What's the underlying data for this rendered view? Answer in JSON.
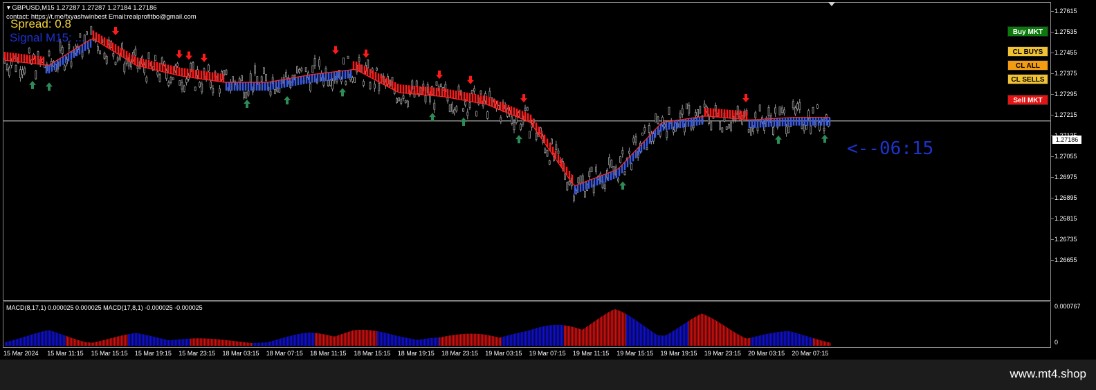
{
  "header": {
    "symbol_line": "GBPUSD,M15  1.27287 1.27287 1.27184 1.27186",
    "contact": "contact:  https://t.me/fxyashwinbest Email:realprofitbo@gmail.com",
    "spread": "Spread: 0.8",
    "signal": "Signal M15: ..."
  },
  "countdown": "<--06:15",
  "buttons": {
    "buy": "Buy MKT",
    "cl_buys": "CL BUYS",
    "cl_all": "CL ALL",
    "cl_sells": "CL SELLS",
    "sell": "Sell MKT"
  },
  "price_axis": {
    "ticks": [
      "1.27615",
      "1.27535",
      "1.27455",
      "1.27375",
      "1.27295",
      "1.27215",
      "1.27135",
      "1.27055",
      "1.26975",
      "1.26895",
      "1.26815",
      "1.26735",
      "1.26655"
    ],
    "current": "1.27186"
  },
  "time_axis": [
    "15 Mar 2024",
    "15 Mar 11:15",
    "15 Mar 15:15",
    "15 Mar 19:15",
    "15 Mar 23:15",
    "18 Mar 03:15",
    "18 Mar 07:15",
    "18 Mar 11:15",
    "18 Mar 15:15",
    "18 Mar 19:15",
    "18 Mar 23:15",
    "19 Mar 03:15",
    "19 Mar 07:15",
    "19 Mar 11:15",
    "19 Mar 15:15",
    "19 Mar 19:15",
    "19 Mar 23:15",
    "20 Mar 03:15",
    "20 Mar 07:15"
  ],
  "macd": {
    "label": "MACD(8,17,1) 0.000025 0.000025  MACD(17,8,1) -0.000025 -0.000025",
    "axis_top": "0.000767",
    "axis_zero": "0"
  },
  "watermark": "www.mt4.shop",
  "colors": {
    "up_arrow": "#2e8b57",
    "down_arrow": "#ff1a1a",
    "trend_up": "#3a5be0",
    "trend_down": "#ff1a1a",
    "candle": "#9a9a9a",
    "macd_up": "#1010d0",
    "macd_down": "#d01010"
  },
  "chart_data": {
    "type": "candlestick",
    "symbol": "GBPUSD",
    "timeframe": "M15",
    "last_price": 1.27186,
    "ylim": [
      1.26655,
      1.27655
    ],
    "trend_line": [
      {
        "t": "15 Mar 2024",
        "price": 1.2742
      },
      {
        "t": "15 Mar 11:15",
        "price": 1.274
      },
      {
        "t": "15 Mar 15:15",
        "price": 1.27505
      },
      {
        "t": "15 Mar 19:15",
        "price": 1.274
      },
      {
        "t": "15 Mar 23:15",
        "price": 1.2736
      },
      {
        "t": "18 Mar 03:15",
        "price": 1.27335
      },
      {
        "t": "18 Mar 07:15",
        "price": 1.27335
      },
      {
        "t": "18 Mar 11:15",
        "price": 1.27365
      },
      {
        "t": "18 Mar 15:15",
        "price": 1.27385
      },
      {
        "t": "18 Mar 19:15",
        "price": 1.27295
      },
      {
        "t": "18 Mar 23:15",
        "price": 1.2728
      },
      {
        "t": "19 Mar 03:15",
        "price": 1.2725
      },
      {
        "t": "19 Mar 07:15",
        "price": 1.2718
      },
      {
        "t": "19 Mar 11:15",
        "price": 1.26935
      },
      {
        "t": "19 Mar 15:15",
        "price": 1.27
      },
      {
        "t": "19 Mar 19:15",
        "price": 1.2718
      },
      {
        "t": "19 Mar 23:15",
        "price": 1.27205
      },
      {
        "t": "20 Mar 03:15",
        "price": 1.2719
      },
      {
        "t": "20 Mar 07:15",
        "price": 1.272
      }
    ],
    "macd_hist": [
      0.00012,
      0.0003,
      9e-05,
      0.00025,
      0.00017,
      0.00012,
      8e-05,
      0.00028,
      0.00035,
      0.00022,
      0.00018,
      0.00027,
      0.0003,
      0.0005,
      0.00072,
      0.0003,
      0.00062,
      0.00025,
      0.00028,
      0.0001
    ],
    "macd_ylim": [
      0,
      0.000767
    ]
  }
}
